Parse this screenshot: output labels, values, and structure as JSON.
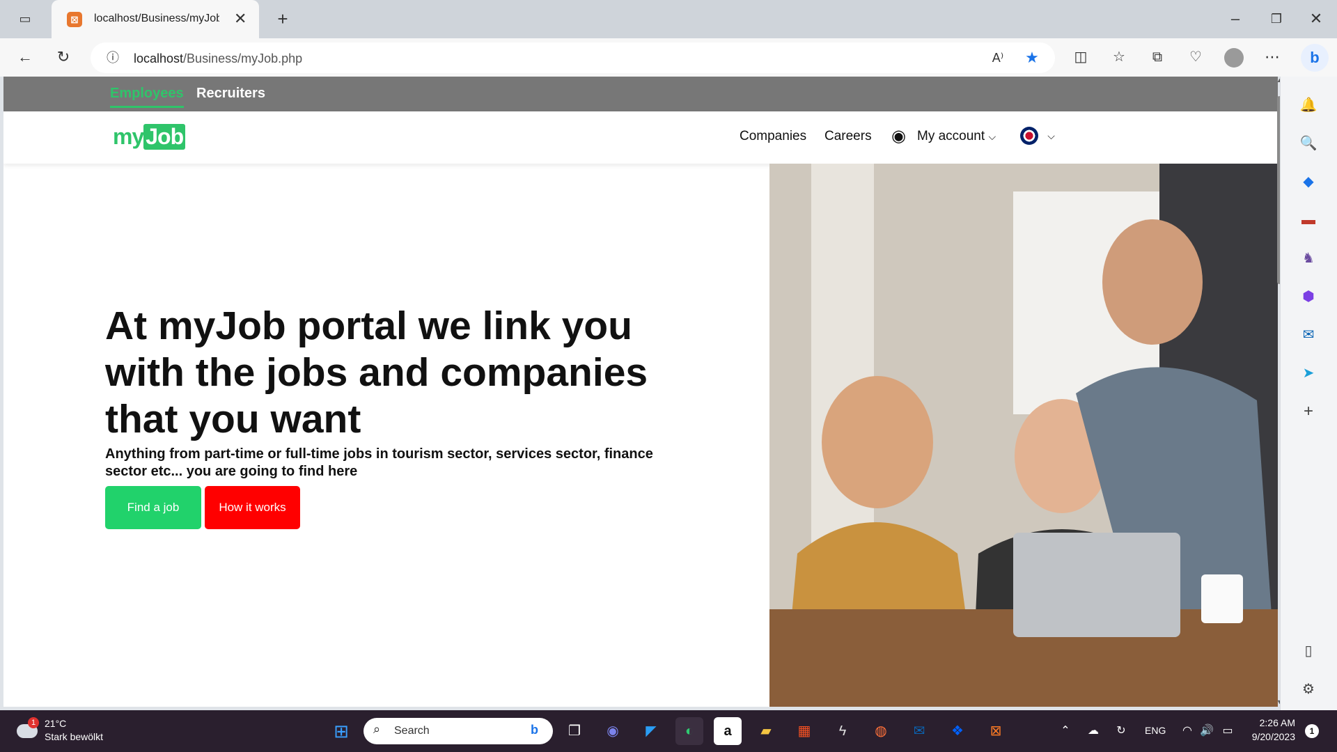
{
  "browser": {
    "tab_title": "localhost/Business/myJob.p",
    "new_tab_glyph": "+",
    "url_host": "localhost",
    "url_path": "/Business/myJob.php"
  },
  "site": {
    "top_links": [
      "Employees",
      "Recruiters"
    ],
    "logo_prefix": "my",
    "logo_box": "Job",
    "nav": {
      "companies": "Companies",
      "careers": "Careers",
      "account": "My account"
    },
    "hero": {
      "title": "At myJob portal we link you with the jobs and companies that you want",
      "subtitle": "Anything from part-time or full-time jobs in tourism sector, services sector, finance sector etc... you are going to find here",
      "find_job": "Find a job",
      "how_it_works": "How it works"
    },
    "colors": {
      "accent_green": "#2fc46a",
      "button_red": "#ff0000",
      "topstrip": "#777777"
    }
  },
  "taskbar": {
    "weather_temp": "21°C",
    "weather_desc": "Stark bewölkt",
    "weather_badge": "1",
    "search_placeholder": "Search",
    "lang": "ENG",
    "time": "2:26 AM",
    "date": "9/20/2023",
    "notif_count": "1"
  },
  "icons": [
    "back-icon",
    "refresh-icon",
    "info-icon",
    "read-aloud-icon",
    "favorite-star-icon",
    "split-screen-icon",
    "favorites-icon",
    "collections-icon",
    "performance-icon",
    "profile-icon",
    "more-icon",
    "bing-icon",
    "user-circle-icon",
    "uk-flag-icon"
  ]
}
